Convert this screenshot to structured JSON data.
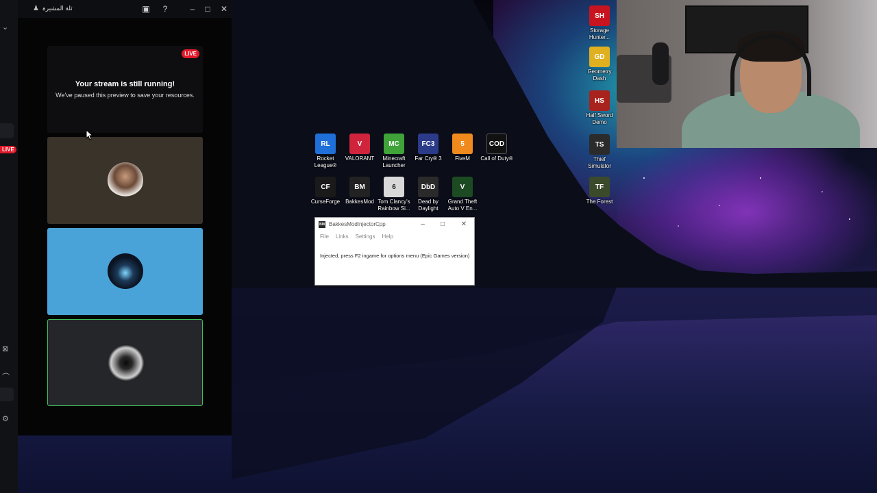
{
  "discord_window": {
    "title": "ثلة المشيرة",
    "stream_tile": {
      "badge": "LIVE",
      "title": "Your stream is still running!",
      "subtitle": "We've paused this preview to save your resources."
    },
    "left_badge": "LIVE"
  },
  "desktop_icons": [
    {
      "label": "Rocket League®",
      "color": "#1f6fd8",
      "glyph": "RL"
    },
    {
      "label": "VALORANT",
      "color": "#d0243d",
      "glyph": "V"
    },
    {
      "label": "Minecraft Launcher",
      "color": "#3fa33a",
      "glyph": "MC"
    },
    {
      "label": "Far Cry® 3",
      "color": "#2b3b8a",
      "glyph": "FC3"
    },
    {
      "label": "FiveM",
      "color": "#f08a1c",
      "glyph": "5"
    },
    {
      "label": "Call of Duty®",
      "color": "#111111",
      "glyph": "COD"
    },
    {
      "label": "CurseForge",
      "color": "#1a1a1a",
      "glyph": "CF"
    },
    {
      "label": "BakkesMod",
      "color": "#222222",
      "glyph": "BM"
    },
    {
      "label": "Tom Clancy's Rainbow Si...",
      "color": "#d9d9d9",
      "glyph": "6"
    },
    {
      "label": "Dead by Daylight",
      "color": "#2a2a2a",
      "glyph": "DbD"
    },
    {
      "label": "Grand Theft Auto V En...",
      "color": "#1c4a22",
      "glyph": "V"
    },
    {
      "label": "Storage Hunter...",
      "color": "#c8141e",
      "glyph": "SH"
    },
    {
      "label": "Geometry Dash",
      "color": "#e0b020",
      "glyph": "GD"
    },
    {
      "label": "Half Sword Demo",
      "color": "#a8221e",
      "glyph": "HS"
    },
    {
      "label": "Thief Simulator",
      "color": "#2b2b2b",
      "glyph": "TS"
    },
    {
      "label": "The Forest",
      "color": "#3a4a2a",
      "glyph": "TF"
    }
  ],
  "injector": {
    "title": "BakkesModInjectorCpp",
    "menu": [
      "File",
      "Links",
      "Settings",
      "Help"
    ],
    "message": "Injected, press F2 ingame for options menu (Epic Games version)"
  }
}
